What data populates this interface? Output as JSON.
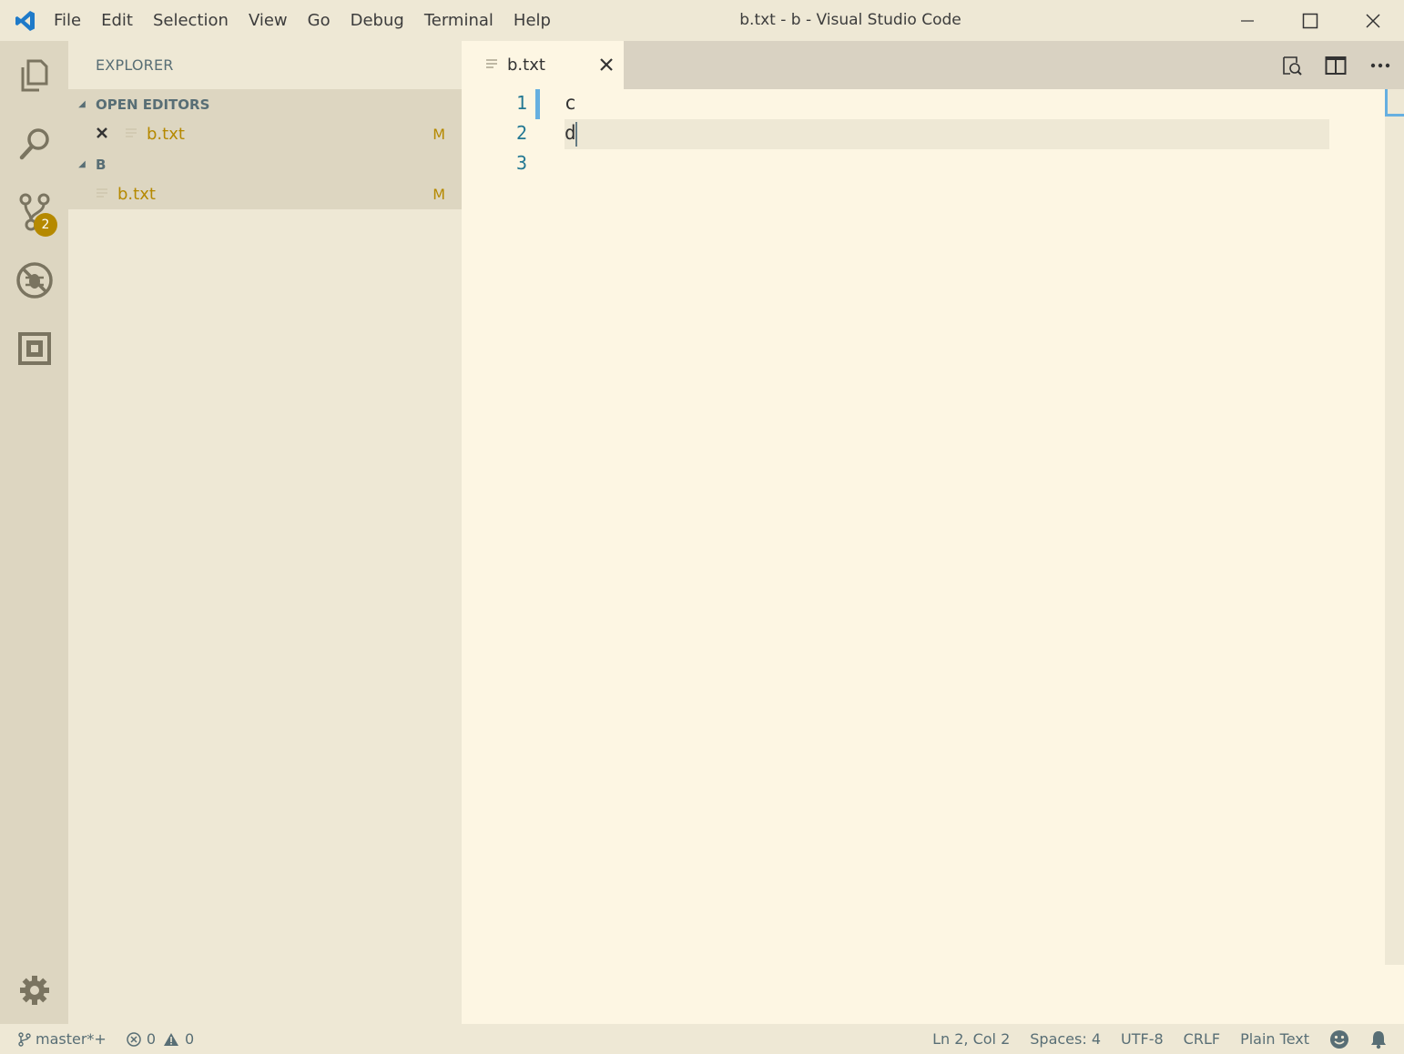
{
  "window": {
    "title": "b.txt - b - Visual Studio Code"
  },
  "menu": [
    "File",
    "Edit",
    "Selection",
    "View",
    "Go",
    "Debug",
    "Terminal",
    "Help"
  ],
  "activity": {
    "scm_badge": "2"
  },
  "sidebar": {
    "title": "EXPLORER",
    "open_editors": {
      "header": "OPEN EDITORS",
      "items": [
        {
          "name": "b.txt",
          "status": "M"
        }
      ]
    },
    "folder": {
      "header": "B",
      "items": [
        {
          "name": "b.txt",
          "status": "M"
        }
      ]
    }
  },
  "editor": {
    "tab": {
      "title": "b.txt"
    },
    "lines": [
      {
        "number": "1",
        "text": "c"
      },
      {
        "number": "2",
        "text": "d"
      },
      {
        "number": "3",
        "text": ""
      }
    ]
  },
  "statusbar": {
    "branch": "master*+",
    "errors": "0",
    "warnings": "0",
    "position": "Ln 2, Col 2",
    "spaces": "Spaces: 4",
    "encoding": "UTF-8",
    "eol": "CRLF",
    "language": "Plain Text"
  },
  "colors": {
    "accent": "#b58900",
    "blue": "#66afe0",
    "background": "#fdf6e3"
  }
}
